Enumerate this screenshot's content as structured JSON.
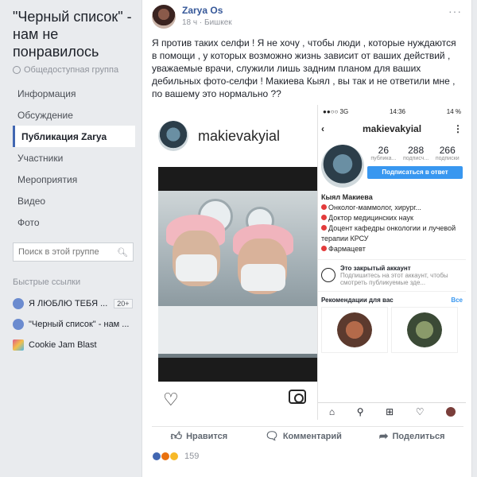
{
  "group": {
    "title": "\"Черный список\" - нам не понравилось",
    "type": "Общедоступная группа"
  },
  "nav": [
    {
      "label": "Информация",
      "active": false
    },
    {
      "label": "Обсуждение",
      "active": false
    },
    {
      "label": "Публикация Zarya",
      "active": true
    },
    {
      "label": "Участники",
      "active": false
    },
    {
      "label": "Мероприятия",
      "active": false
    },
    {
      "label": "Видео",
      "active": false
    },
    {
      "label": "Фото",
      "active": false
    }
  ],
  "search": {
    "placeholder": "Поиск в этой группе"
  },
  "quick_links": {
    "heading": "Быстрые ссылки",
    "items": [
      {
        "label": "Я ЛЮБЛЮ ТЕБЯ ...",
        "badge": "20+"
      },
      {
        "label": "\"Черный список\" - нам ...",
        "badge": ""
      },
      {
        "label": "Cookie Jam Blast",
        "badge": ""
      }
    ]
  },
  "post": {
    "author": "Zarya Os",
    "time": "18 ч",
    "location": "Бишкек",
    "text": "Я против таких селфи ! Я не хочу , чтобы люди , которые нуждаются в помощи , у которых возможно жизнь зависит от ваших действий , уважаемые врачи, служили лишь задним планом для ваших дебильных фото-селфи ! Макиева Кыял , вы так и не ответили мне , по вашему это нормально ??",
    "menu": "···"
  },
  "insta_post": {
    "username": "makievakyial"
  },
  "insta_profile": {
    "status_left": "●●○○ 3G",
    "status_time": "14:36",
    "status_right": "14 %",
    "username": "makievakyial",
    "stats": [
      {
        "num": "26",
        "label": "публика..."
      },
      {
        "num": "288",
        "label": "подписч..."
      },
      {
        "num": "266",
        "label": "подписки"
      }
    ],
    "follow_label": "Подписаться в ответ",
    "bio_name": "Кыял Макиева",
    "bio_lines": [
      "Онколог-маммолог, хирург...",
      "Доктор медицинских наук",
      "Доцент кафедры онкологии и лучевой терапии КРСУ",
      "Фармацевт"
    ],
    "private_title": "Это закрытый аккаунт",
    "private_desc": "Подпишитесь на этот аккаунт, чтобы смотреть публикуемые зде...",
    "recs_title": "Рекомендации для вас",
    "recs_all": "Все"
  },
  "actions": {
    "like": "Нравится",
    "comment": "Комментарий",
    "share": "Поделиться"
  },
  "reactions": {
    "count": "159"
  }
}
